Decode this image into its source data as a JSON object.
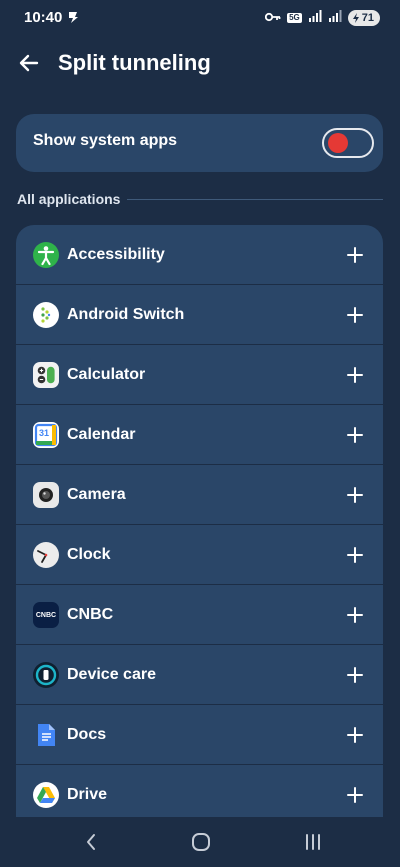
{
  "status_bar": {
    "time": "10:40",
    "network_label": "5G",
    "battery": "71"
  },
  "header": {
    "title": "Split tunneling"
  },
  "system_apps": {
    "label": "Show system apps",
    "enabled": false,
    "toggle_color": "#e53935"
  },
  "section": {
    "title": "All applications"
  },
  "apps": [
    {
      "name": "Accessibility",
      "icon": "accessibility-icon"
    },
    {
      "name": "Android Switch",
      "icon": "android-switch-icon"
    },
    {
      "name": "Calculator",
      "icon": "calculator-icon"
    },
    {
      "name": "Calendar",
      "icon": "calendar-icon",
      "icon_text": "31"
    },
    {
      "name": "Camera",
      "icon": "camera-icon"
    },
    {
      "name": "Clock",
      "icon": "clock-icon"
    },
    {
      "name": "CNBC",
      "icon": "cnbc-icon",
      "icon_text": "CNBC"
    },
    {
      "name": "Device care",
      "icon": "device-care-icon"
    },
    {
      "name": "Docs",
      "icon": "docs-icon"
    },
    {
      "name": "Drive",
      "icon": "drive-icon"
    }
  ],
  "colors": {
    "background": "#1c2d45",
    "card": "#2a4668",
    "text": "#ffffff"
  }
}
